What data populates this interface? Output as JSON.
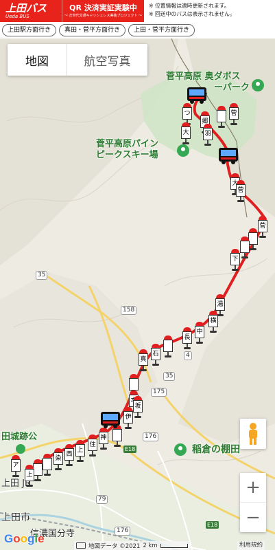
{
  "header": {
    "brand_name": "上田バス",
    "brand_sub": "Ueda BUS",
    "qr_title": "QR 決済実証実験中",
    "qr_sub": "〜 次世代交通キャッシュレス実装プロジェクト 〜",
    "notes": [
      "※ 位置情報は適時更新されます。",
      "※ 回送中のバスは表示されません。"
    ]
  },
  "directions": [
    "上田駅方面行き",
    "真田・菅平方面行き",
    "上田・菅平方面行き"
  ],
  "map": {
    "type_map": "地図",
    "type_satellite": "航空写真",
    "places": {
      "dam_park_1": "菅平高原 奥ダボス",
      "dam_park_2": "ーパーク",
      "ski_1": "菅平高原パイン",
      "ski_2": "ピークスキー場",
      "castle": "田城跡公",
      "ueda_jr": "上田 JR",
      "ueda_city": "上田市",
      "temple": "信濃国分寺",
      "rice": "稲倉の棚田"
    },
    "route_numbers": [
      "35",
      "158",
      "4",
      "35",
      "175",
      "176",
      "79",
      "176"
    ],
    "highways": [
      "E18",
      "E18"
    ],
    "attribution": "地図データ ©2021",
    "scale": "2 km",
    "terms": "利用規約",
    "google": [
      "G",
      "o",
      "o",
      "g",
      "l",
      "e"
    ],
    "zoom_in": "+",
    "zoom_out": "−"
  },
  "stops": [
    {
      "label": "つ"
    },
    {
      "label": "大"
    },
    {
      "label": "郷"
    },
    {
      "label": "菅"
    },
    {
      "label": ""
    },
    {
      "label": "羽"
    },
    {
      "label": "大"
    },
    {
      "label": "菅"
    },
    {
      "label": "菅"
    },
    {
      "label": ""
    },
    {
      "label": ""
    },
    {
      "label": "下"
    },
    {
      "label": "湯"
    },
    {
      "label": "横"
    },
    {
      "label": "中"
    },
    {
      "label": "長"
    },
    {
      "label": ""
    },
    {
      "label": "石"
    },
    {
      "label": "真"
    },
    {
      "label": ""
    },
    {
      "label": "本"
    },
    {
      "label": "坂"
    },
    {
      "label": "伊"
    },
    {
      "label": ""
    },
    {
      "label": "神"
    },
    {
      "label": "住"
    },
    {
      "label": "上"
    },
    {
      "label": "西"
    },
    {
      "label": "染"
    },
    {
      "label": ""
    },
    {
      "label": ""
    },
    {
      "label": "上"
    },
    {
      "label": "ア"
    }
  ],
  "colors": {
    "brand_red": "#e8231b",
    "route_red": "#e02020",
    "park_green": "#cfe5c6",
    "road_yellow": "#f4d36b"
  }
}
